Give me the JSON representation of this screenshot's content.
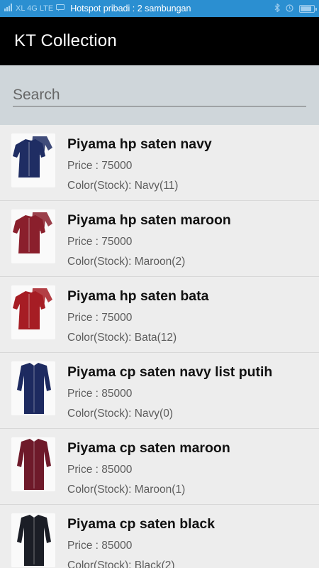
{
  "status_bar": {
    "carrier": "XL 4G LTE",
    "hotspot_text": "Hotspot pribadi : 2 sambungan",
    "battery_level": 0.9,
    "icons": [
      "signal-icon",
      "message-icon",
      "bluetooth-icon",
      "alarm-icon",
      "battery-icon"
    ]
  },
  "app_bar": {
    "title": "KT Collection"
  },
  "search": {
    "placeholder": "Search",
    "value": ""
  },
  "products": [
    {
      "name": "Piyama hp saten navy",
      "price": "Price : 75000",
      "stock": "Color(Stock): Navy(11)",
      "thumb_color": "#1f2d63",
      "style": "short"
    },
    {
      "name": "Piyama hp saten maroon",
      "price": "Price : 75000",
      "stock": "Color(Stock): Maroon(2)",
      "thumb_color": "#8a1f2c",
      "style": "short"
    },
    {
      "name": "Piyama hp saten bata",
      "price": "Price : 75000",
      "stock": "Color(Stock): Bata(12)",
      "thumb_color": "#a61d24",
      "style": "short"
    },
    {
      "name": "Piyama cp saten navy list putih",
      "price": "Price : 85000",
      "stock": "Color(Stock): Navy(0)",
      "thumb_color": "#1d2a60",
      "style": "long"
    },
    {
      "name": "Piyama cp saten maroon",
      "price": "Price : 85000",
      "stock": "Color(Stock): Maroon(1)",
      "thumb_color": "#6e1a2a",
      "style": "long"
    },
    {
      "name": "Piyama cp saten black",
      "price": "Price : 85000",
      "stock": "Color(Stock): Black(2)",
      "thumb_color": "#1b1e26",
      "style": "long"
    }
  ]
}
